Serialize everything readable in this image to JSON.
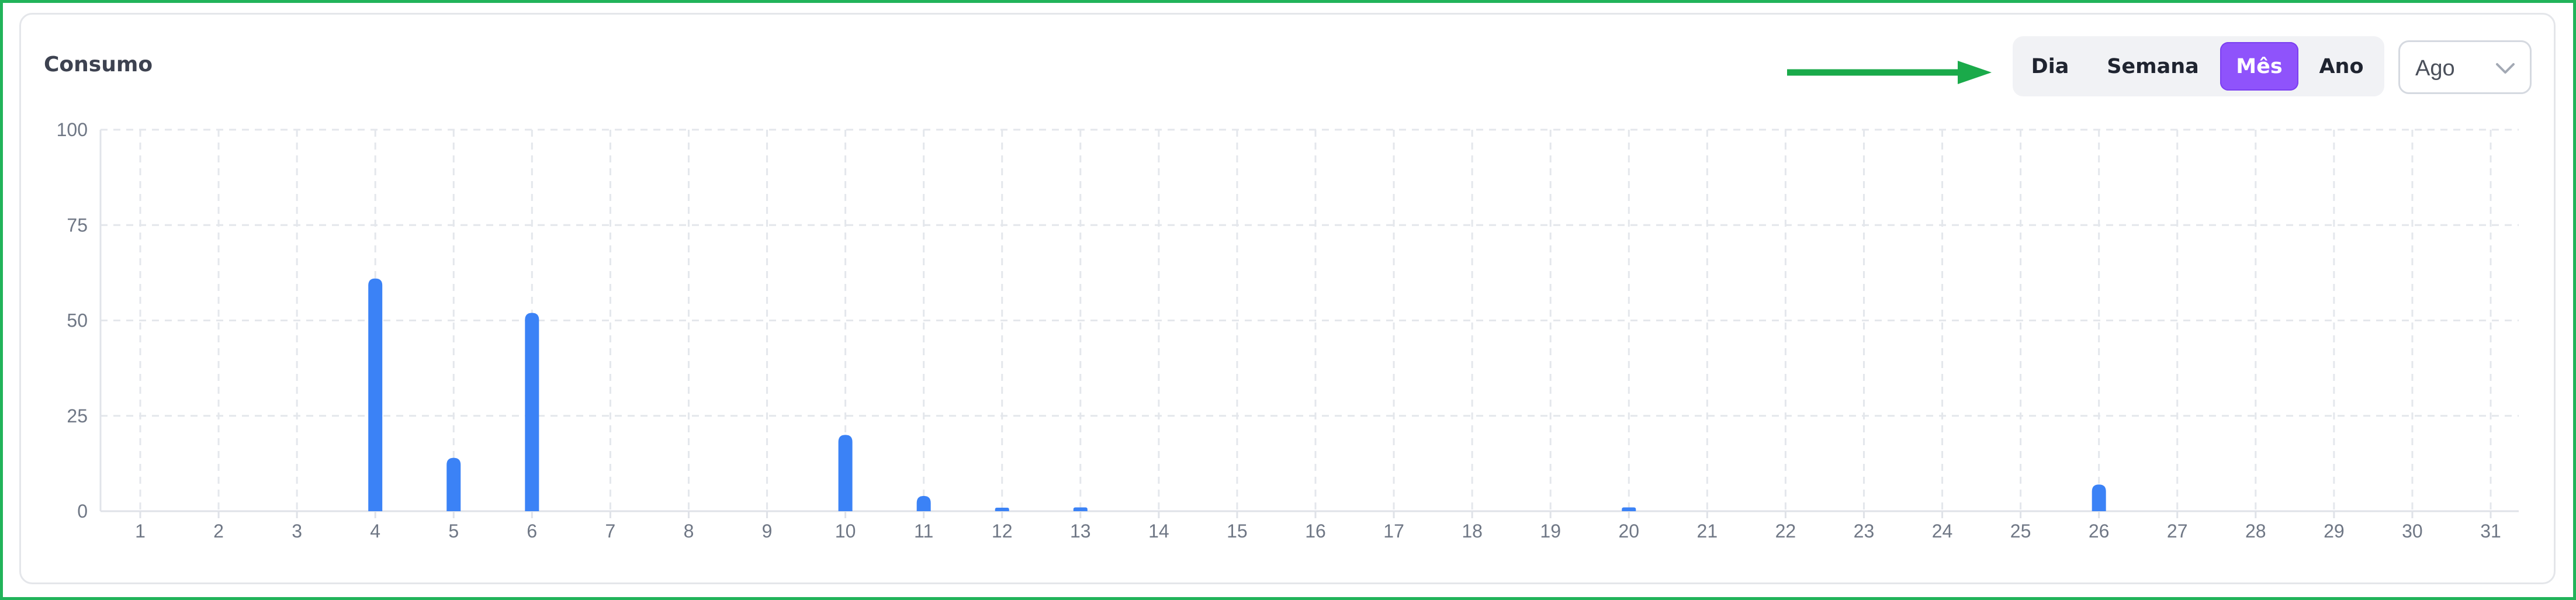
{
  "header": {
    "title": "Consumo"
  },
  "period_tabs": [
    {
      "label": "Dia",
      "active": false
    },
    {
      "label": "Semana",
      "active": false
    },
    {
      "label": "Mês",
      "active": true
    },
    {
      "label": "Ano",
      "active": false
    }
  ],
  "month_select": {
    "value": "Ago",
    "icon": "chevron-down-icon"
  },
  "annotation": {
    "icon": "arrow-right-icon",
    "color": "#1aaa4a"
  },
  "colors": {
    "accent": "#8f53fb",
    "bar": "#3b82f6",
    "frame": "#22b35a"
  },
  "chart_data": {
    "type": "bar",
    "title": "Consumo",
    "xlabel": "",
    "ylabel": "",
    "categories": [
      "1",
      "2",
      "3",
      "4",
      "5",
      "6",
      "7",
      "8",
      "9",
      "10",
      "11",
      "12",
      "13",
      "14",
      "15",
      "16",
      "17",
      "18",
      "19",
      "20",
      "21",
      "22",
      "23",
      "24",
      "25",
      "26",
      "27",
      "28",
      "29",
      "30",
      "31"
    ],
    "values": [
      0,
      0,
      0,
      61,
      14,
      52,
      0,
      0,
      0,
      20,
      4,
      0.5,
      1,
      0,
      0,
      0,
      0,
      0,
      0,
      1,
      0,
      0,
      0,
      0,
      0,
      7,
      0,
      0,
      0,
      0,
      0
    ],
    "ylim": [
      0,
      100
    ],
    "yticks": [
      0,
      25,
      50,
      75,
      100
    ],
    "grid": true,
    "bar_color": "#3b82f6"
  }
}
